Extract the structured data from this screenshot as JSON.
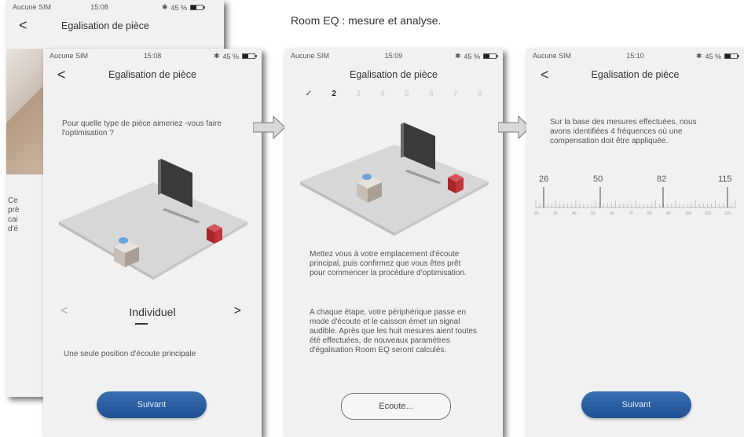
{
  "caption": "Room EQ : mesure et analyse.",
  "status": {
    "carrier": "Aucune SIM",
    "battery": "45 %",
    "times": [
      "15:08",
      "15:08",
      "15:09",
      "15:10"
    ]
  },
  "nav_title": "Egalisation de pièce",
  "back_glyph": "<",
  "screen_back": {
    "partial_text": [
      "Ce",
      "prè",
      "cai",
      "d'é"
    ]
  },
  "screen1": {
    "question": "Pour quelle type de pièce aimeriez -vous faire l'optimisation ?",
    "selector_value": "Individuel",
    "prev_glyph": "<",
    "next_glyph": ">",
    "description": "Une seule position d'écoute principale",
    "button_label": "Suivant"
  },
  "screen2": {
    "steps": [
      "✓",
      "2",
      "3",
      "4",
      "5",
      "6",
      "7",
      "8"
    ],
    "paragraph1": "Mettez vous à votre emplacement d'écoute principal, puis confirmez que vous êtes prêt pour commencer la procédure d'optimisation.",
    "paragraph2": "A chaque étape, votre périphérique passe en mode d'écoute et le caisson émet un signal audible. Après que les huit mesures aient toutes été effectuées, de nouveaux paramètres d'égalisation Room EQ seront calculés.",
    "button_label": "Ecoute..."
  },
  "screen3": {
    "paragraph": "Sur la base des mesures effectuées, nous avons identifiées 4 fréquences où une compensation doit être appliquée.",
    "frequencies": [
      "26",
      "50",
      "82",
      "115"
    ],
    "scale_labels": [
      "20",
      "30",
      "40",
      "50",
      "60",
      "70",
      "80",
      "90",
      "100",
      "110",
      "120"
    ],
    "button_label": "Suivant"
  },
  "colors": {
    "accent_blue": "#1e4f94",
    "screen_bg": "#f1f1f1",
    "speaker_red": "#b3272d"
  }
}
